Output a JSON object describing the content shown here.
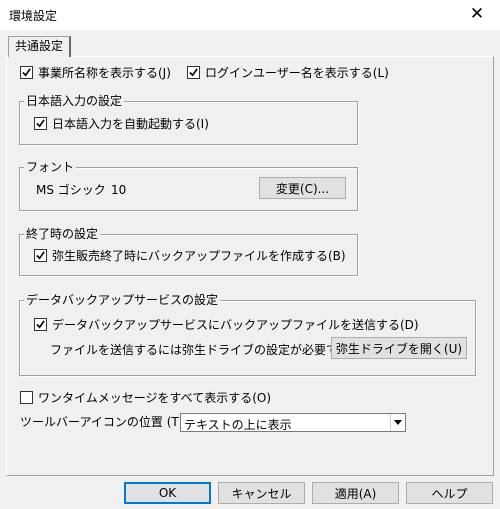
{
  "window": {
    "title": "環境設定",
    "close": "✕"
  },
  "tabs": [
    {
      "label": "共通設定"
    }
  ],
  "general": {
    "show_office_name": {
      "label": "事業所名称を表示する(J)",
      "checked": true
    },
    "show_login_user": {
      "label": "ログインユーザー名を表示する(L)",
      "checked": true
    }
  },
  "ime_group": {
    "title": "日本語入力の設定",
    "auto_start": {
      "label": "日本語入力を自動起動する(I)",
      "checked": true
    }
  },
  "font_group": {
    "title": "フォント",
    "font_name": "MS ゴシック",
    "font_size": "10",
    "change_button": "変更(C)..."
  },
  "exit_group": {
    "title": "終了時の設定",
    "create_backup": {
      "label": "弥生販売終了時にバックアップファイルを作成する(B)",
      "checked": true
    }
  },
  "data_backup_group": {
    "title": "データバックアップサービスの設定",
    "send_backup": {
      "label": "データバックアップサービスにバックアップファイルを送信する(D)",
      "checked": true
    },
    "note": "ファイルを送信するには弥生ドライブの設定が必要です",
    "open_drive_button": "弥生ドライブを開く(U)"
  },
  "onetime": {
    "label": "ワンタイムメッセージをすべて表示する(O)",
    "checked": false
  },
  "toolbar_icon": {
    "label": "ツールバーアイコンの位置 (T):",
    "value": "テキストの上に表示"
  },
  "footer": {
    "ok": "OK",
    "cancel": "キャンセル",
    "apply": "適用(A)",
    "help": "ヘルプ"
  },
  "colors": {
    "focus": "#0078d7",
    "face": "#f0f0f0"
  }
}
